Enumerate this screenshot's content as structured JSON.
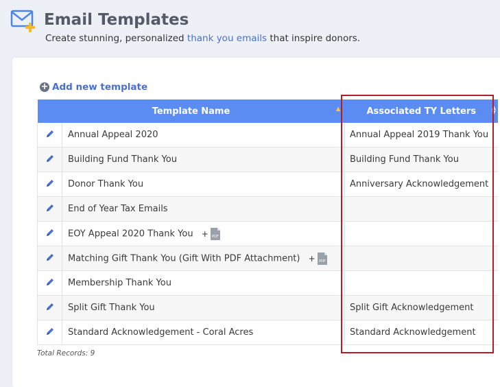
{
  "header": {
    "title": "Email Templates",
    "subtitle_prefix": "Create stunning, personalized ",
    "subtitle_link": "thank you emails",
    "subtitle_suffix": " that inspire donors."
  },
  "toolbar": {
    "add_label": "Add new template"
  },
  "table": {
    "columns": [
      "Template Name",
      "Associated TY Letters"
    ],
    "rows": [
      {
        "name": "Annual Appeal 2020",
        "assoc": "Annual Appeal 2019 Thank You",
        "pdf": false
      },
      {
        "name": "Building Fund Thank You",
        "assoc": "Building Fund Thank You",
        "pdf": false
      },
      {
        "name": "Donor Thank You",
        "assoc": "Anniversary Acknowledgement",
        "pdf": false
      },
      {
        "name": "End of Year Tax Emails",
        "assoc": "",
        "pdf": false
      },
      {
        "name": "EOY Appeal 2020 Thank You",
        "assoc": "",
        "pdf": true
      },
      {
        "name": "Matching Gift Thank You (Gift With PDF Attachment)",
        "assoc": "",
        "pdf": true
      },
      {
        "name": "Membership Thank You",
        "assoc": "",
        "pdf": false
      },
      {
        "name": "Split Gift Thank You",
        "assoc": "Split Gift Acknowledgement",
        "pdf": false
      },
      {
        "name": "Standard Acknowledgement - Coral Acres",
        "assoc": "Standard Acknowledgement",
        "pdf": false
      }
    ]
  },
  "pdf": {
    "plus": "+",
    "label": "PDF"
  },
  "footer": {
    "total_records": "Total Records: 9"
  },
  "colors": {
    "accent": "#5a8cf2",
    "link": "#4a6fd0",
    "highlight": "#b21e26"
  },
  "icons": [
    "envelope-plus-icon",
    "plus-circle-icon",
    "pencil-icon",
    "pdf-icon",
    "sort-asc-icon",
    "sort-both-icon"
  ]
}
